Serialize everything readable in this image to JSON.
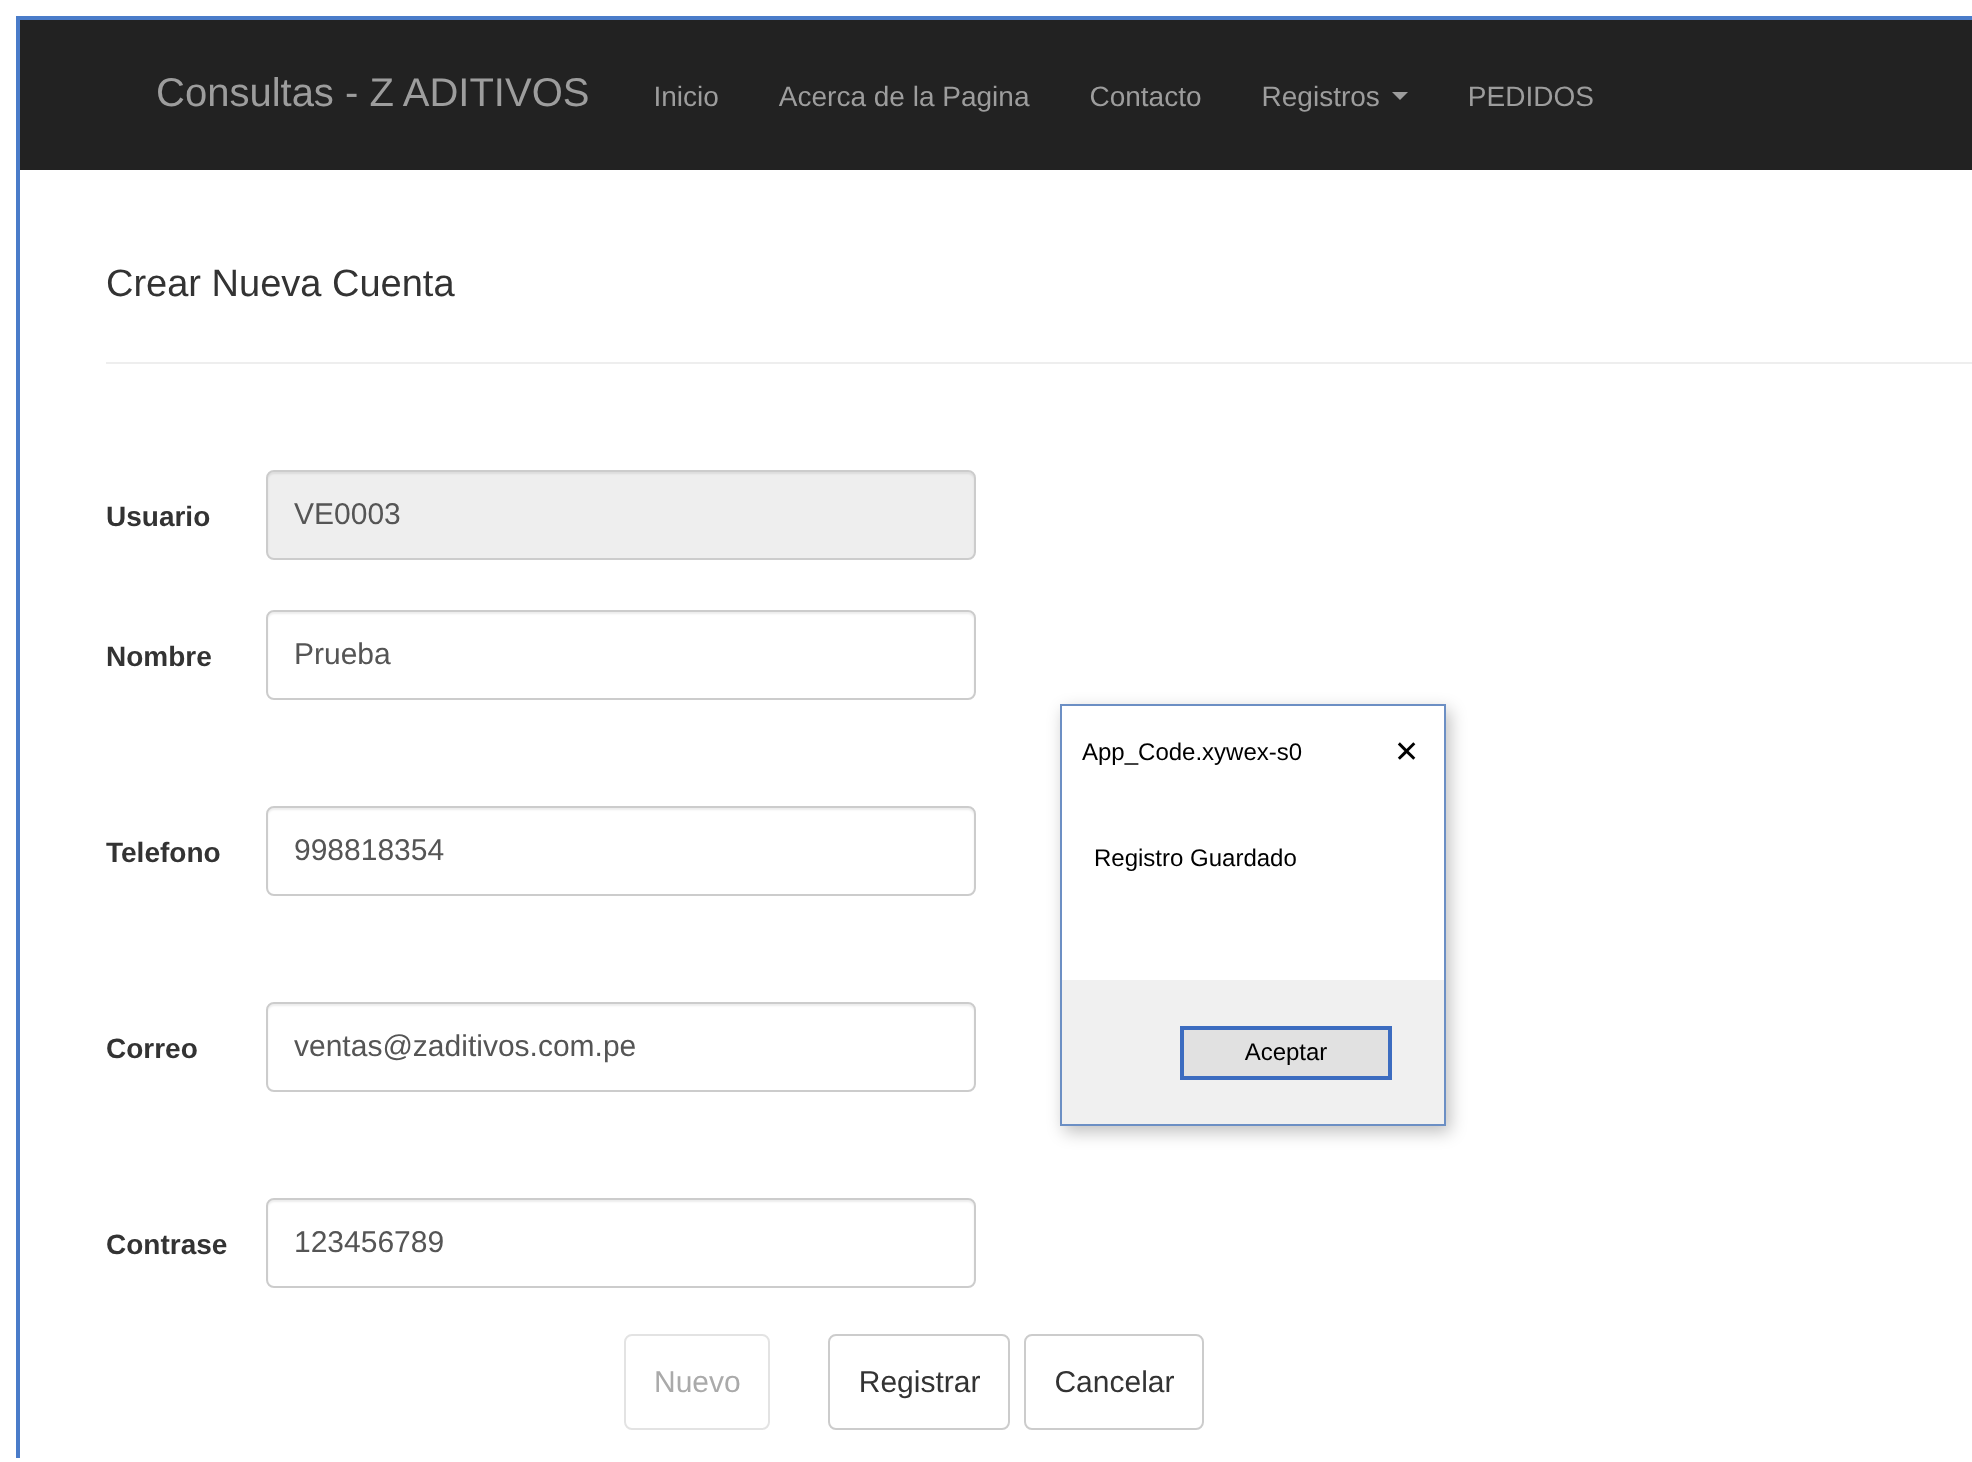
{
  "navbar": {
    "brand": "Consultas - Z ADITIVOS",
    "items": [
      {
        "label": "Inicio",
        "kind": "link"
      },
      {
        "label": "Acerca de la Pagina",
        "kind": "link"
      },
      {
        "label": "Contacto",
        "kind": "link"
      },
      {
        "label": "Registros",
        "kind": "dropdown"
      },
      {
        "label": "PEDIDOS",
        "kind": "link"
      }
    ]
  },
  "page_title": "Crear Nueva Cuenta",
  "form": {
    "fields": [
      {
        "label": "Usuario",
        "value": "VE0003",
        "disabled": true
      },
      {
        "label": "Nombre",
        "value": "Prueba",
        "disabled": false
      },
      {
        "label": "Telefono",
        "value": "998818354",
        "disabled": false
      },
      {
        "label": "Correo",
        "value": "ventas@zaditivos.com.pe",
        "disabled": false
      },
      {
        "label": "Contrase",
        "value": "123456789",
        "disabled": false
      }
    ],
    "buttons": [
      {
        "label": "Nuevo",
        "disabled": true
      },
      {
        "label": "Registrar",
        "disabled": false
      },
      {
        "label": "Cancelar",
        "disabled": false
      }
    ]
  },
  "dialog": {
    "title": "App_Code.xywex-s0",
    "close": "✕",
    "message": "Registro Guardado",
    "button": "Aceptar"
  }
}
